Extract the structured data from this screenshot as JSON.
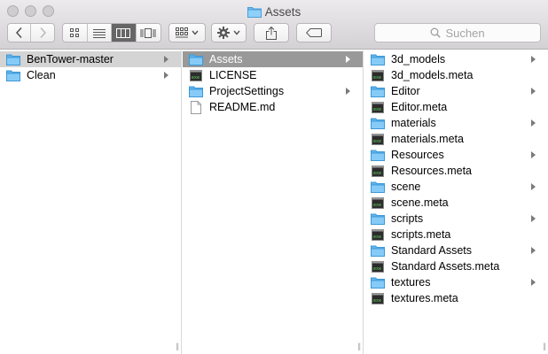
{
  "window": {
    "title": "Assets"
  },
  "toolbar": {
    "search_placeholder": "Suchen"
  },
  "columns": [
    {
      "items": [
        {
          "label": "BenTower-master",
          "kind": "folder",
          "chevron": true,
          "selected": "gray"
        },
        {
          "label": "Clean",
          "kind": "folder",
          "chevron": true
        }
      ]
    },
    {
      "items": [
        {
          "label": "Assets",
          "kind": "folder",
          "chevron": true,
          "selected": "blue"
        },
        {
          "label": "LICENSE",
          "kind": "exec"
        },
        {
          "label": "ProjectSettings",
          "kind": "folder",
          "chevron": true
        },
        {
          "label": "README.md",
          "kind": "doc"
        }
      ]
    },
    {
      "items": [
        {
          "label": "3d_models",
          "kind": "folder",
          "chevron": true
        },
        {
          "label": "3d_models.meta",
          "kind": "exec"
        },
        {
          "label": "Editor",
          "kind": "folder",
          "chevron": true
        },
        {
          "label": "Editor.meta",
          "kind": "exec"
        },
        {
          "label": "materials",
          "kind": "folder",
          "chevron": true
        },
        {
          "label": "materials.meta",
          "kind": "exec"
        },
        {
          "label": "Resources",
          "kind": "folder",
          "chevron": true
        },
        {
          "label": "Resources.meta",
          "kind": "exec"
        },
        {
          "label": "scene",
          "kind": "folder",
          "chevron": true
        },
        {
          "label": "scene.meta",
          "kind": "exec"
        },
        {
          "label": "scripts",
          "kind": "folder",
          "chevron": true
        },
        {
          "label": "scripts.meta",
          "kind": "exec"
        },
        {
          "label": "Standard Assets",
          "kind": "folder",
          "chevron": true
        },
        {
          "label": "Standard Assets.meta",
          "kind": "exec"
        },
        {
          "label": "textures",
          "kind": "folder",
          "chevron": true
        },
        {
          "label": "textures.meta",
          "kind": "exec"
        }
      ]
    }
  ]
}
